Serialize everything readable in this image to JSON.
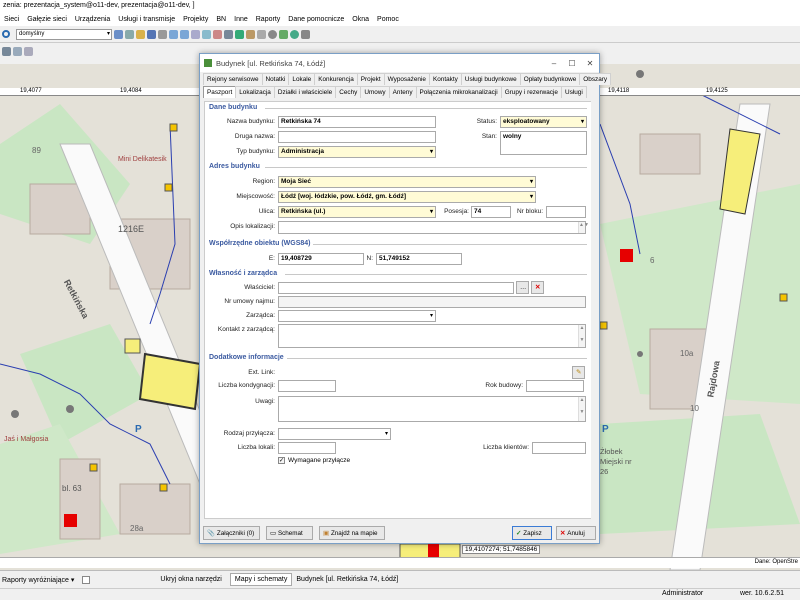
{
  "window": {
    "title": "zenia: prezentacja_system@o11-dev, prezentacja@o11-dev, ]"
  },
  "menu": [
    "Sieci",
    "Gałęzie sieci",
    "Urządzenia",
    "Usługi i transmisje",
    "Projekty",
    "BN",
    "Inne",
    "Raporty",
    "Dane pomocnicze",
    "Okna",
    "Pomoc"
  ],
  "toolbar": {
    "style_select": "domyślny"
  },
  "map": {
    "ruler": [
      "19,4077",
      "19,4084",
      "19,4118",
      "19,4125"
    ],
    "labels": {
      "street1": "Retkińska",
      "street2": "Rajdowa",
      "building1": "1216E",
      "number89": "89",
      "number10a": "10a",
      "number6": "6",
      "number10": "10",
      "number63": "bl. 63",
      "number28a": "28a",
      "shop": "Mini Delikatesik",
      "malgosia": "Jaś i Małgosia",
      "school": "Żłobek Miejski nr 26",
      "parking": "P"
    },
    "coords": "19,4107274; 51,7485846",
    "data_source": "Dane: OpenStre"
  },
  "dialog": {
    "title": "Budynek [ul. Retkińska 74, Łódź]",
    "tabs_row1": [
      "Rejony serwisowe",
      "Notatki",
      "Lokale",
      "Konkurencja",
      "Projekt",
      "Wyposażenie",
      "Kontakty",
      "Usługi budynkowe",
      "Opłaty budynkowe",
      "Obszary"
    ],
    "tabs_row2": [
      "Paszport",
      "Lokalizacja",
      "Działki i właściciele",
      "Cechy",
      "Umowy",
      "Anteny",
      "Połączenia mikrokanalizacji",
      "Grupy i rezerwacje",
      "Usługi"
    ],
    "sections": {
      "dane": "Dane budynku",
      "adres": "Adres budynku",
      "wsp": "Współrzędne obiektu (WGS84)",
      "wlasnosc": "Własność i zarządca",
      "dodatkowe": "Dodatkowe informacje"
    },
    "labels": {
      "nazwa": "Nazwa budynku:",
      "druga": "Druga nazwa:",
      "typ": "Typ budynku:",
      "status": "Status:",
      "stan": "Stan:",
      "region": "Region:",
      "miejscowosc": "Miejscowość:",
      "ulica": "Ulica:",
      "posesja": "Posesja:",
      "nrbloku": "Nr bloku:",
      "opis": "Opis lokalizacji:",
      "e": "E:",
      "n": "N:",
      "wlasciciel": "Właściciel:",
      "nrumowy": "Nr umowy najmu:",
      "zarzadca": "Zarządca:",
      "kontakt": "Kontakt z zarządcą:",
      "extlink": "Ext. Link:",
      "kondygnacje": "Liczba kondygnacji:",
      "rok": "Rok budowy:",
      "uwagi": "Uwagi:",
      "rodzaj": "Rodzaj przyłącza:",
      "lokale": "Liczba lokali:",
      "klienci": "Liczba klientów:",
      "wymagane": "Wymagane przyłącze"
    },
    "values": {
      "nazwa": "Retkińska 74",
      "typ": "Administracja",
      "status": "eksploatowany",
      "stan": "wolny",
      "region": "Moja Sieć",
      "miejscowosc": "Łódź   [woj. łódzkie, pow. Łódź, gm. Łódź]",
      "ulica": "Retkińska (ul.)",
      "posesja": "74",
      "e": "19,408729",
      "n": "51,749152"
    },
    "buttons": {
      "zalaczniki": "Załączniki (0)",
      "schemat": "Schemat",
      "znajdz": "Znajdź na mapie",
      "zapisz": "Zapisz",
      "anuluj": "Anuluj"
    }
  },
  "bottom": {
    "reports": "Raporty wyróżniające",
    "hide": "Ukryj okna narzędzi",
    "tab1": "Mapy i schematy",
    "tab2": "Budynek [ul. Retkińska 74, Łódź]"
  },
  "status": {
    "user": "Administrator",
    "version": "wer. 10.6.2.51"
  }
}
